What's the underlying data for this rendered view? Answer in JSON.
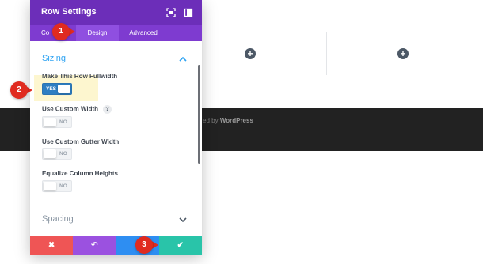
{
  "canvas": {
    "add_icon_glyph": "+",
    "footer_prefix": "ed by",
    "footer_brand": "WordPress"
  },
  "modal": {
    "title": "Row Settings",
    "header_icons": [
      "expand-icon",
      "sidebar-icon"
    ],
    "tabs": [
      {
        "label": "Co",
        "active": false
      },
      {
        "label": "Design",
        "active": true
      },
      {
        "label": "Advanced",
        "active": false
      }
    ],
    "sections": {
      "sizing": {
        "title": "Sizing",
        "expanded": true
      },
      "spacing": {
        "title": "Spacing",
        "expanded": false
      }
    },
    "fields": [
      {
        "label": "Make This Row Fullwidth",
        "state": "YES",
        "on": true,
        "help": false
      },
      {
        "label": "Use Custom Width",
        "state": "NO",
        "on": false,
        "help": true,
        "help_glyph": "?"
      },
      {
        "label": "Use Custom Gutter Width",
        "state": "NO",
        "on": false,
        "help": false
      },
      {
        "label": "Equalize Column Heights",
        "state": "NO",
        "on": false,
        "help": false
      }
    ],
    "footer_buttons": [
      {
        "name": "discard",
        "glyph": "✖",
        "color": "#ef5555"
      },
      {
        "name": "undo",
        "glyph": "↶",
        "color": "#9b51e0"
      },
      {
        "name": "redo",
        "glyph": "",
        "color": "#2e8ef2"
      },
      {
        "name": "save",
        "glyph": "✔",
        "color": "#29c4a9"
      }
    ]
  },
  "callouts": [
    "1",
    "2",
    "3"
  ],
  "colors": {
    "header": "#6c2eb9",
    "tabs": "#7e3bd0",
    "accent": "#2ea3f2",
    "callout": "#e02b20",
    "footer_band": "#222222"
  }
}
